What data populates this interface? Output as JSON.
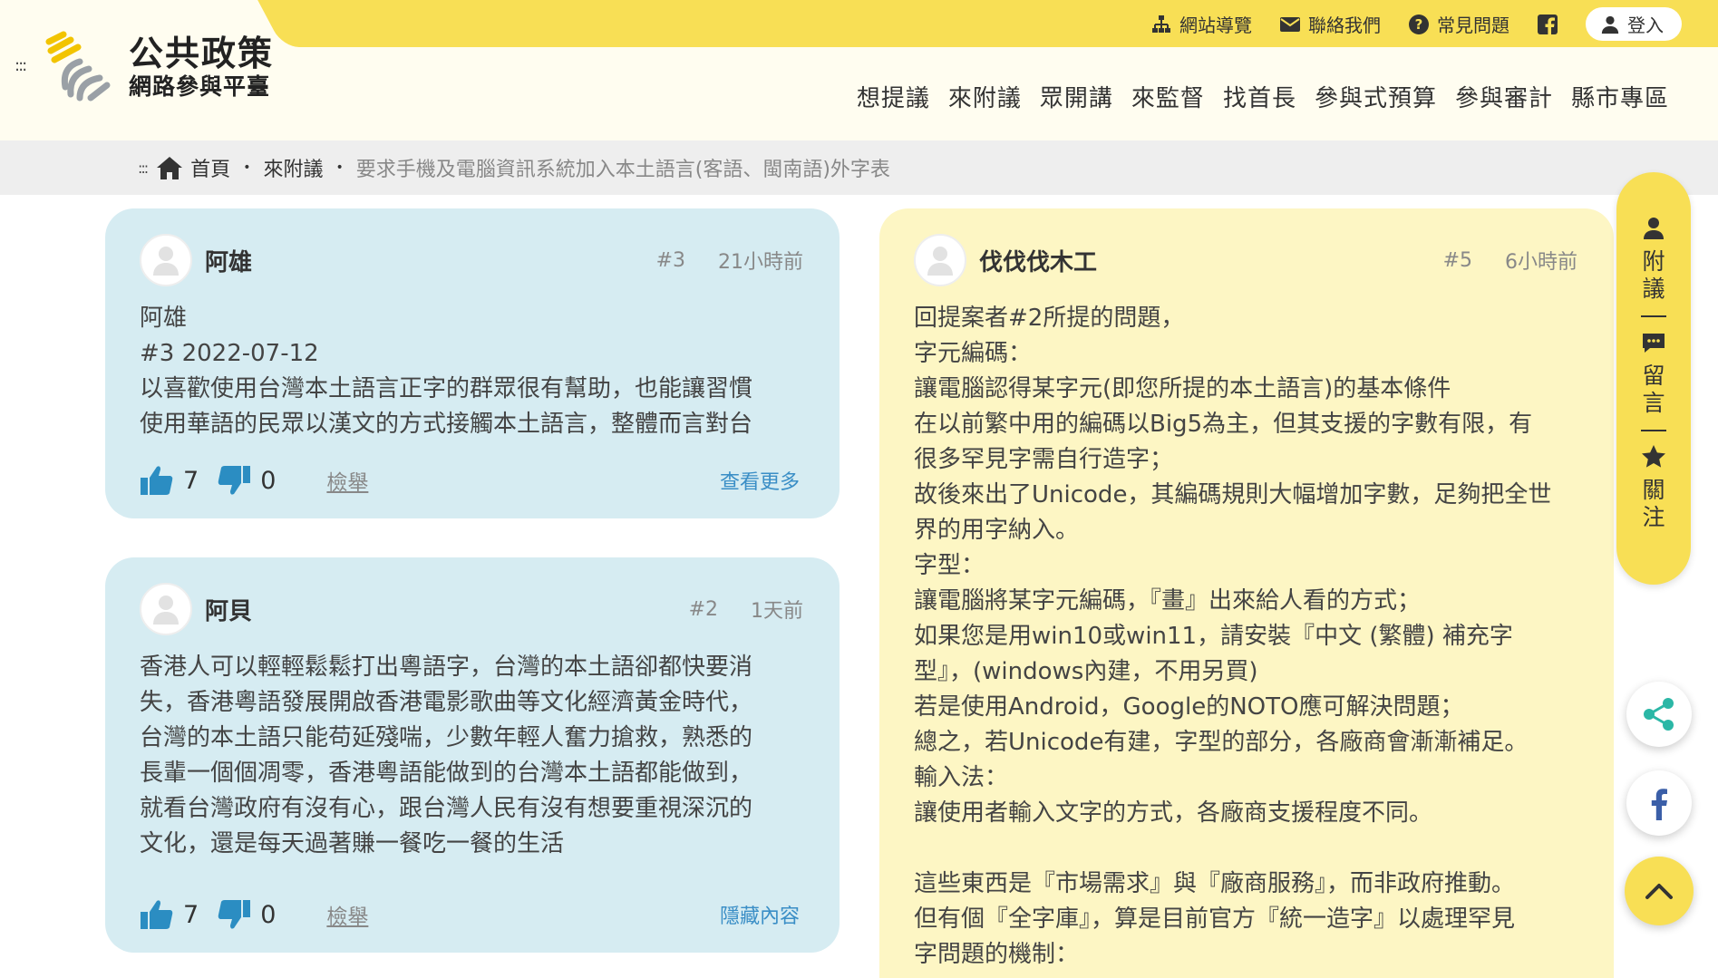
{
  "top_links": [
    {
      "label": "網站導覽",
      "icon": "sitemap-icon"
    },
    {
      "label": "聯絡我們",
      "icon": "mail-icon"
    },
    {
      "label": "常見問題",
      "icon": "question-icon"
    }
  ],
  "login_label": "登入",
  "logo": {
    "title": "公共政策",
    "subtitle": "網路參與平臺"
  },
  "menu_dots": ":::",
  "nav": [
    "想提議",
    "來附議",
    "眾開講",
    "來監督",
    "找首長",
    "參與式預算",
    "參與審計",
    "縣市專區"
  ],
  "breadcrumb": {
    "dots": ":::",
    "home": "首頁",
    "section": "來附議",
    "current": "要求手機及電腦資訊系統加入本土語言(客語、閩南語)外字表",
    "separator": "•"
  },
  "comments": [
    {
      "author": "阿雄",
      "number": "#3",
      "time": "21小時前",
      "lines": [
        "阿雄",
        "#3 2022-07-12",
        "以喜歡使用台灣本土語言正字的群眾很有幫助，也能讓習慣",
        "使用華語的民眾以漢文的方式接觸本土語言，整體而言對台"
      ],
      "likes": "7",
      "dislikes": "0",
      "report": "檢舉",
      "toggle": "查看更多"
    },
    {
      "author": "阿貝",
      "number": "#2",
      "time": "1天前",
      "lines": [
        "香港人可以輕輕鬆鬆打出粵語字，台灣的本土語卻都快要消",
        "失，香港粵語發展開啟香港電影歌曲等文化經濟黃金時代，",
        "台灣的本土語只能苟延殘喘，少數年輕人奮力搶救，熟悉的",
        "長輩一個個凋零，香港粵語能做到的台灣本土語都能做到，",
        "就看台灣政府有沒有心，跟台灣人民有沒有想要重視深沉的",
        "文化，還是每天過著賺一餐吃一餐的生活"
      ],
      "likes": "7",
      "dislikes": "0",
      "report": "檢舉",
      "toggle": "隱藏內容"
    },
    {
      "author": "伐伐伐木工",
      "number": "#5",
      "time": "6小時前",
      "lines": [
        "回提案者#2所提的問題，",
        "字元編碼：",
        "讓電腦認得某字元(即您所提的本土語言)的基本條件",
        "在以前繁中用的編碼以Big5為主，但其支援的字數有限，有",
        "很多罕見字需自行造字；",
        "故後來出了Unicode，其編碼規則大幅增加字數，足夠把全世",
        "界的用字納入。",
        "字型：",
        "讓電腦將某字元編碼，『畫』出來給人看的方式；",
        "如果您是用win10或win11，請安裝『中文 (繁體) 補充字",
        "型』，(windows內建，不用另買)",
        "若是使用Android，Google的NOTO應可解決問題；",
        "總之，若Unicode有建，字型的部分，各廠商會漸漸補足。",
        "輸入法：",
        "讓使用者輸入文字的方式，各廠商支援程度不同。",
        "",
        "這些東西是『市場需求』與『廠商服務』，而非政府推動。",
        "但有個『全字庫』，算是目前官方『統一造字』以處理罕見",
        "字問題的機制："
      ]
    }
  ],
  "sidebar": {
    "items": [
      {
        "label": "附議",
        "icon": "person-icon"
      },
      {
        "label": "留言",
        "icon": "chat-icon"
      },
      {
        "label": "關注",
        "icon": "star-icon"
      }
    ]
  },
  "colors": {
    "brand_yellow": "#f8df55",
    "card_blue": "#d6ecf2",
    "card_yellow": "#fdf6c4",
    "thumb_blue": "#2b8dc2",
    "link_blue": "#3a8ec6"
  }
}
